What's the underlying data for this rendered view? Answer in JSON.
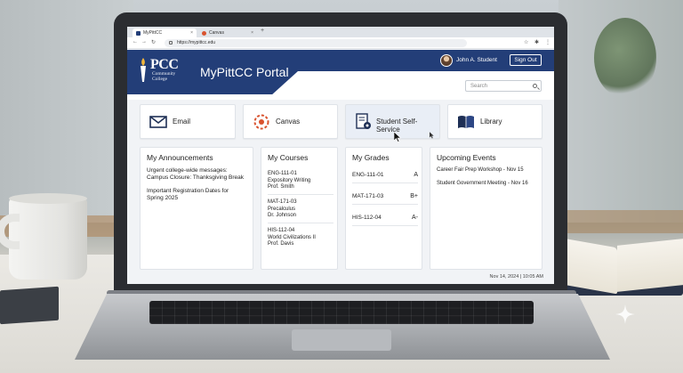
{
  "browser": {
    "tabs": [
      {
        "label": "MyPittCC",
        "active": true
      },
      {
        "label": "Canvas",
        "active": false
      }
    ],
    "url": "https://mypittcc.edu"
  },
  "header": {
    "logo_abbr": "PCC",
    "logo_sub": "Community College",
    "title": "MyPittCC Portal",
    "user_name": "John A. Student",
    "sign_out_label": "Sign Out",
    "search_placeholder": "Search"
  },
  "quick_links": [
    {
      "label": "Email",
      "icon": "envelope-icon"
    },
    {
      "label": "Canvas",
      "icon": "canvas-icon"
    },
    {
      "label": "Student Self-Service",
      "icon": "document-gear-icon"
    },
    {
      "label": "Library",
      "icon": "book-icon"
    }
  ],
  "announcements": {
    "title": "My Announcements",
    "items": [
      "Urgent college-wide messages:",
      "Campus Closure: Thanksgiving Break",
      "Important Registration Dates for",
      "Spring 2025"
    ]
  },
  "courses": {
    "title": "My Courses",
    "items": [
      {
        "code": "ENG-111-01",
        "name": "Expository Writing",
        "instructor": "Prof. Smith"
      },
      {
        "code": "MAT-171-03",
        "name": "Precalculus",
        "instructor": "Dr. Johnson"
      },
      {
        "code": "HIS-112-04",
        "name": "World Civilizations II",
        "instructor": "Prof. Davis"
      }
    ]
  },
  "grades": {
    "title": "My Grades",
    "items": [
      {
        "course": "ENG-111-01",
        "grade": "A"
      },
      {
        "course": "MAT-171-03",
        "grade": "B+"
      },
      {
        "course": "HIS-112-04",
        "grade": "A-"
      }
    ]
  },
  "events": {
    "title": "Upcoming Events",
    "items": [
      "Career Fair Prep Workshop - Nov 15",
      "Student Government Meeting - Nov 16"
    ]
  },
  "footer": {
    "timestamp": "Nov 14, 2024 | 10:05 AM"
  },
  "colors": {
    "brand_blue": "#233e78",
    "canvas_red": "#d9532f"
  }
}
